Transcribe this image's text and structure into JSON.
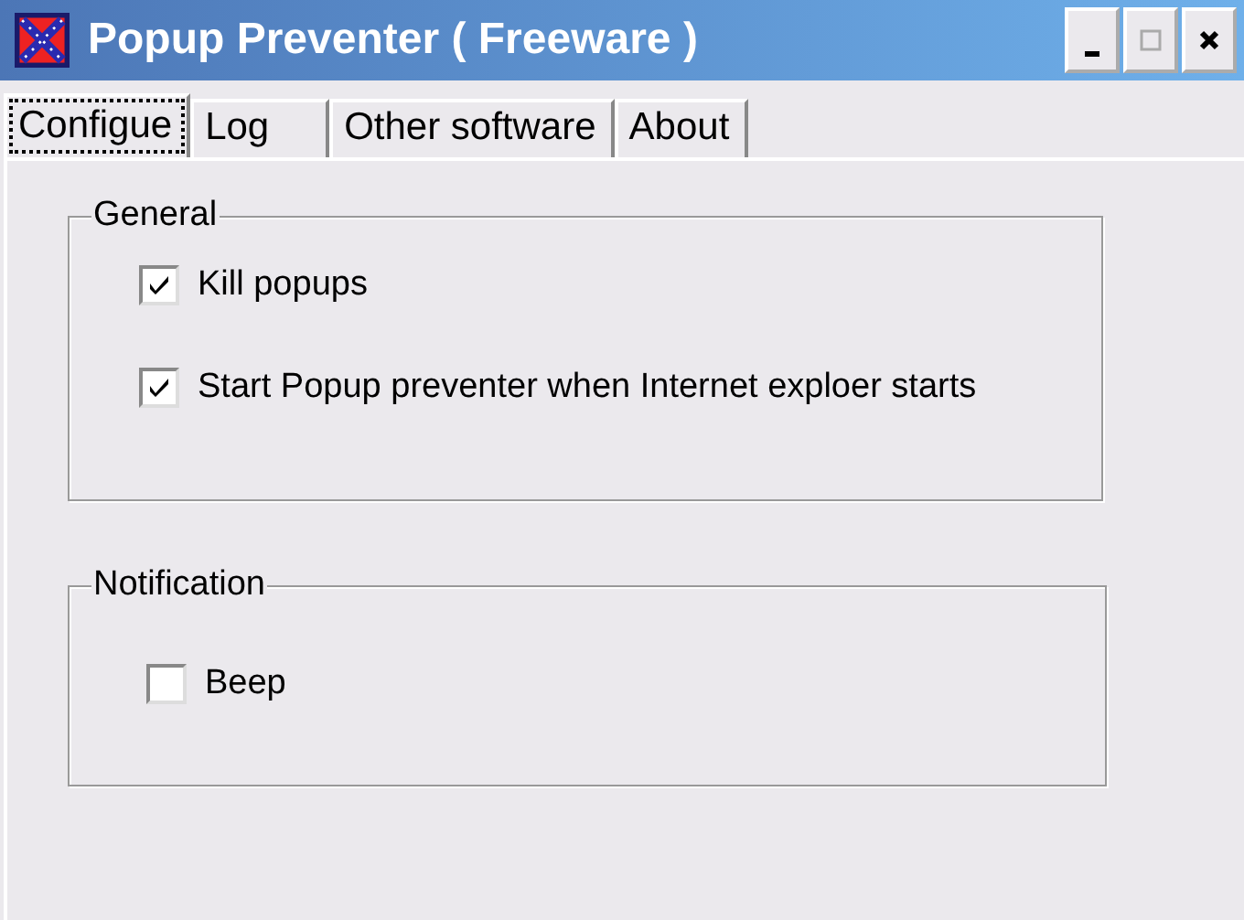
{
  "window": {
    "title": "Popup Preventer ( Freeware )"
  },
  "tabs": [
    {
      "label": "Configue",
      "selected": true
    },
    {
      "label": "Log",
      "selected": false
    },
    {
      "label": "Other software",
      "selected": false
    },
    {
      "label": "About",
      "selected": false
    }
  ],
  "groups": [
    {
      "title": "General",
      "options": [
        {
          "label": "Kill popups",
          "checked": true
        },
        {
          "label": "Start Popup preventer when Internet exploer starts",
          "checked": true
        }
      ]
    },
    {
      "title": "Notification",
      "options": [
        {
          "label": "Beep",
          "checked": false
        }
      ]
    }
  ]
}
